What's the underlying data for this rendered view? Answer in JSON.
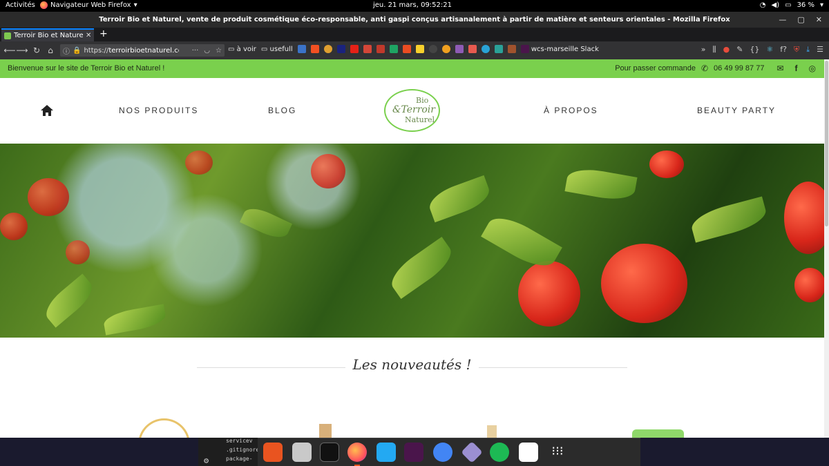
{
  "system": {
    "activities": "Activités",
    "app_name": "Navigateur Web Firefox",
    "clock": "jeu. 21 mars, 09:52:21",
    "battery": "36 %"
  },
  "window": {
    "title": "Terroir Bio et Naturel, vente de produit cosmétique éco-responsable, anti gaspi conçus artisanalement à partir de matière et senteurs orientales - Mozilla Firefox"
  },
  "tab": {
    "title": "Terroir Bio et Naturel, ve"
  },
  "url": {
    "scheme": "https://",
    "host": "terroirbioetnaturel.com"
  },
  "bookmarks": [
    "à voir",
    "usefull",
    "wcs-marseille Slack"
  ],
  "site": {
    "welcome": "Bienvenue sur le site de Terroir Bio et Naturel !",
    "order_label": "Pour passer commande",
    "phone": "06 49 99 87 77",
    "nav": {
      "products": "NOS PRODUITS",
      "blog": "BLOG",
      "about": "À PROPOS",
      "beauty": "BEAUTY PARTY"
    },
    "logo": {
      "line1": "Bio",
      "line2": "&Terroir",
      "line3": "Naturel"
    },
    "section_title": "Les nouveautés !"
  },
  "dock_files": {
    "f1": "servicev",
    "f2": ".gitignore",
    "f3": "package-"
  },
  "colors": {
    "accent_green": "#7ad04d"
  }
}
